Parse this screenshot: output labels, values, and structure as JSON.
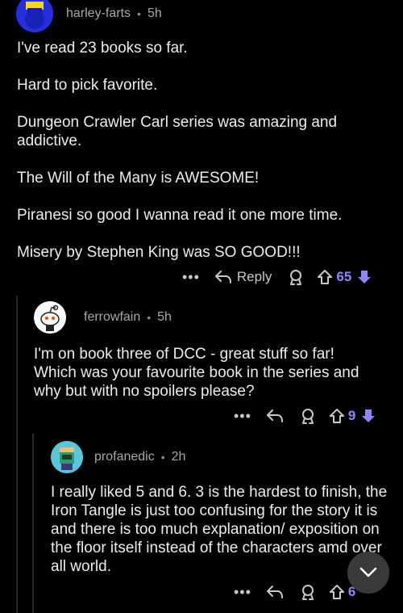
{
  "comments": [
    {
      "author": "harley-farts",
      "separator": "•",
      "time": "5h",
      "paragraphs": [
        "I've read 23 books so far.",
        "Hard to pick favorite.",
        "Dungeon Crawler Carl series was amazing and addictive.",
        "The Will of the Many  is AWESOME!",
        "Piranesi so good I wanna read it one more time.",
        "Misery by Stephen King  was SO GOOD!!!"
      ],
      "more_label": "•••",
      "reply_label": "Reply",
      "votes": "65"
    },
    {
      "author": "ferrowfain",
      "separator": "•",
      "time": "5h",
      "paragraphs": [
        "I'm on book three of DCC - great stuff so far! Which was your favourite book in the series and why but with no spoilers please?"
      ],
      "more_label": "•••",
      "votes": "9"
    },
    {
      "author": "profanedic",
      "separator": "•",
      "time": "2h",
      "paragraphs": [
        "I really liked 5 and 6.  3 is the hardest to finish, the Iron Tangle is just too confusing for the story it is and there is too much explanation/ exposition on the floor itself instead of the characters amd over all world."
      ],
      "more_label": "•••",
      "votes": "6"
    }
  ],
  "colors": {
    "background": "#000000",
    "upvote_accent": "#8e86ff",
    "text": "#ececec",
    "meta": "#a8a8a8"
  },
  "icons": [
    "user-avatar",
    "reply-icon",
    "award-icon",
    "upvote-icon",
    "downvote-icon",
    "chevron-down-icon"
  ]
}
